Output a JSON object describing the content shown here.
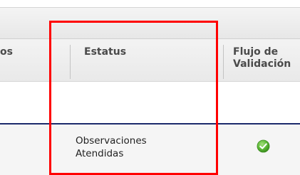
{
  "table": {
    "headers": {
      "partial_column": "os",
      "estatus": "Estatus",
      "flujo_validacion": "Flujo de\nValidación"
    },
    "rows": [
      {
        "estatus": "Observaciones\nAtendidas",
        "flujo_icon": "green-check-icon"
      }
    ]
  },
  "highlight": {
    "color": "#ff0000"
  },
  "colors": {
    "row_separator": "#1c2a6c",
    "check_green": "#5cb836"
  }
}
